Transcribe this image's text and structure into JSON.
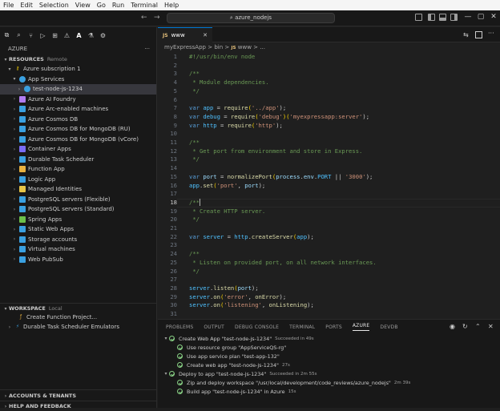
{
  "menu": [
    "File",
    "Edit",
    "Selection",
    "View",
    "Go",
    "Run",
    "Terminal",
    "Help"
  ],
  "titlebar": {
    "search_text": "azure_nodejs"
  },
  "sidebar": {
    "title": "AZURE",
    "more": "···",
    "resources": {
      "label": "RESOURCES",
      "sub": "Remote"
    },
    "subscription": "Azure subscription 1",
    "app_services": "App Services",
    "selected_item": "test-node-js-1234",
    "items": [
      "Azure AI Foundry",
      "Azure Arc-enabled machines",
      "Azure Cosmos DB",
      "Azure Cosmos DB for MongoDB (RU)",
      "Azure Cosmos DB for MongoDB (vCore)",
      "Container Apps",
      "Durable Task Scheduler",
      "Function App",
      "Logic App",
      "Managed Identities",
      "PostgreSQL servers (Flexible)",
      "PostgreSQL servers (Standard)",
      "Spring Apps",
      "Static Web Apps",
      "Storage accounts",
      "Virtual machines",
      "Web PubSub"
    ],
    "workspace": {
      "label": "WORKSPACE",
      "sub": "Local"
    },
    "workspace_items": [
      "Create Function Project...",
      "Durable Task Scheduler Emulators"
    ],
    "accounts": "ACCOUNTS & TENANTS",
    "help": "HELP AND FEEDBACK"
  },
  "editor": {
    "tab": {
      "icon": "JS",
      "label": "www"
    },
    "breadcrumb": {
      "p1": "myExpressApp",
      "sep": ">",
      "p2": "bin",
      "icon": "JS",
      "p3": "www",
      "p4": "..."
    },
    "line_numbers": [
      "1",
      "2",
      "3",
      "4",
      "5",
      "6",
      "7",
      "8",
      "9",
      "10",
      "11",
      "12",
      "13",
      "14",
      "15",
      "16",
      "17",
      "18",
      "19",
      "20",
      "21",
      "22",
      "23",
      "24",
      "25",
      "26",
      "27",
      "28",
      "29",
      "30",
      "31"
    ],
    "code": {
      "l1": "#!/usr/bin/env node",
      "l3": "/**",
      "l4": " * Module dependencies.",
      "l5": " */",
      "l7a": "var ",
      "l7b": "app",
      "l7c": " = ",
      "l7d": "require",
      "l7e": "(",
      "l7f": "'../app'",
      "l7g": ");",
      "l8a": "var ",
      "l8b": "debug",
      "l8c": " = ",
      "l8d": "require",
      "l8e": "(",
      "l8f": "'debug'",
      "l8g": ")(",
      "l8h": "'myexpressapp:server'",
      "l8i": ");",
      "l9a": "var ",
      "l9b": "http",
      "l9c": " = ",
      "l9d": "require",
      "l9e": "(",
      "l9f": "'http'",
      "l9g": ");",
      "l11": "/**",
      "l12": " * Get port from environment and store in Express.",
      "l13": " */",
      "l15a": "var ",
      "l15b": "port",
      "l15c": " = ",
      "l15d": "normalizePort",
      "l15e": "(",
      "l15f": "process",
      "l15g": ".",
      "l15h": "env",
      "l15i": ".",
      "l15j": "PORT",
      "l15k": " || ",
      "l15l": "'3000'",
      "l15m": ");",
      "l16a": "app",
      "l16b": ".",
      "l16c": "set",
      "l16d": "(",
      "l16e": "'port'",
      "l16f": ", ",
      "l16g": "port",
      "l16h": ");",
      "l18": "/**",
      "l19": " * Create HTTP server.",
      "l20": " */",
      "l22a": "var ",
      "l22b": "server",
      "l22c": " = ",
      "l22d": "http",
      "l22e": ".",
      "l22f": "createServer",
      "l22g": "(",
      "l22h": "app",
      "l22i": ");",
      "l24": "/**",
      "l25": " * Listen on provided port, on all network interfaces.",
      "l26": " */",
      "l28a": "server",
      "l28b": ".",
      "l28c": "listen",
      "l28d": "(",
      "l28e": "port",
      "l28f": ");",
      "l29a": "server",
      "l29b": ".",
      "l29c": "on",
      "l29d": "(",
      "l29e": "'error'",
      "l29f": ", ",
      "l29g": "onError",
      "l29h": ");",
      "l30a": "server",
      "l30b": ".",
      "l30c": "on",
      "l30d": "(",
      "l30e": "'listening'",
      "l30f": ", ",
      "l30g": "onListening",
      "l30h": ");"
    }
  },
  "panel": {
    "tabs": [
      "PROBLEMS",
      "OUTPUT",
      "DEBUG CONSOLE",
      "TERMINAL",
      "PORTS",
      "AZURE",
      "DEVDB"
    ],
    "active_tab": "AZURE",
    "activities": [
      {
        "text": "Create Web App \"test-node-js-1234\"",
        "status": "Succeeded in 49s"
      },
      {
        "text": "Use resource group \"AppServiceQS-rg\"",
        "status": ""
      },
      {
        "text": "Use app service plan \"test-app-132\"",
        "status": ""
      },
      {
        "text": "Create web app \"test-node-js-1234\"",
        "status": "27s"
      },
      {
        "text": "Deploy to app \"test-node-js-1234\"",
        "status": "Succeeded in 2m 55s"
      },
      {
        "text": "Zip and deploy workspace \"/usr/local/development/code_reviews/azure_nodejs\"",
        "status": "2m 39s"
      },
      {
        "text": "Build app \"test-node-js-1234\" in Azure",
        "status": "15s"
      }
    ]
  },
  "colors": {
    "accent": "#0078d4",
    "success": "#89d185"
  }
}
